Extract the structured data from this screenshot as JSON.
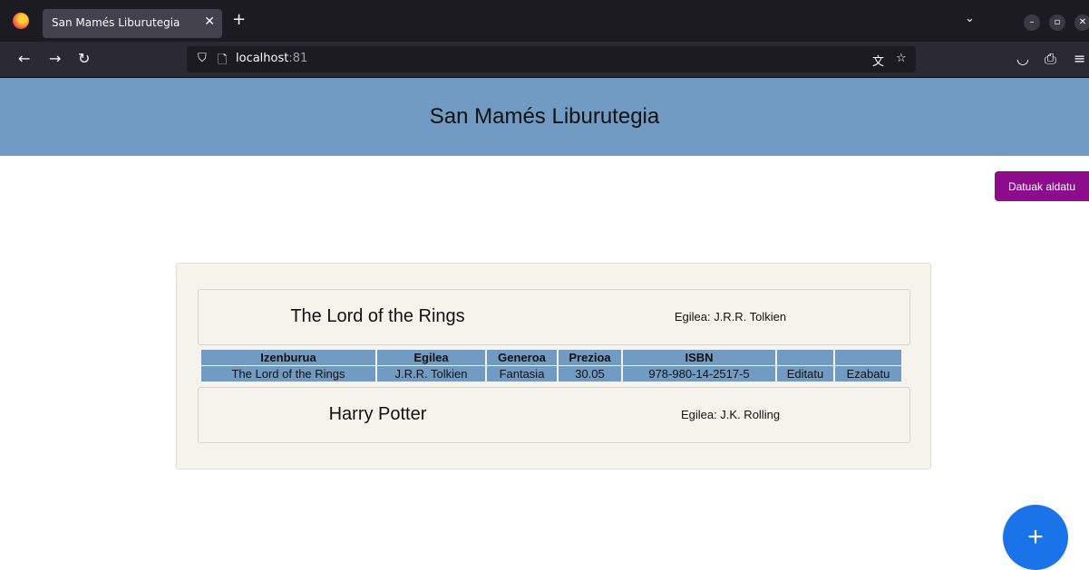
{
  "browser": {
    "tab_title": "San Mamés Liburutegia",
    "url_host": "localhost",
    "url_port": ":81",
    "icons": [
      "firefox-logo",
      "close-icon",
      "plus-icon",
      "chevron-down-icon",
      "back-icon",
      "forward-icon",
      "reload-icon",
      "shield-icon",
      "page-icon",
      "translate-icon",
      "star-icon",
      "pocket-icon",
      "extensions-icon",
      "menu-icon"
    ]
  },
  "header": {
    "title": "San Mamés Liburutegia"
  },
  "logout_button": {
    "label": "Datuak aldatu"
  },
  "books": [
    {
      "title": "The Lord of the Rings",
      "author_line": "Egilea: J.R.R. Tolkien"
    },
    {
      "title": "Harry Potter",
      "author_line": "Egilea: J.K. Rolling"
    }
  ],
  "table": {
    "headers": [
      "Izenburua",
      "Egilea",
      "Generoa",
      "Prezioa",
      "ISBN",
      "",
      ""
    ],
    "row": {
      "title": "The Lord of the Rings",
      "author": "J.R.R. Tolkien",
      "genre": "Fantasia",
      "price": "30.05",
      "isbn": "978-980-14-2517-5",
      "edit": "Editatu",
      "delete": "Ezabatu"
    }
  },
  "fab": {
    "label": "+"
  },
  "colors": {
    "header_bg": "#729bc3",
    "button_purple": "#8d0c8d",
    "fab_blue": "#1a73e8",
    "panel_bg": "#f6f3ec"
  }
}
